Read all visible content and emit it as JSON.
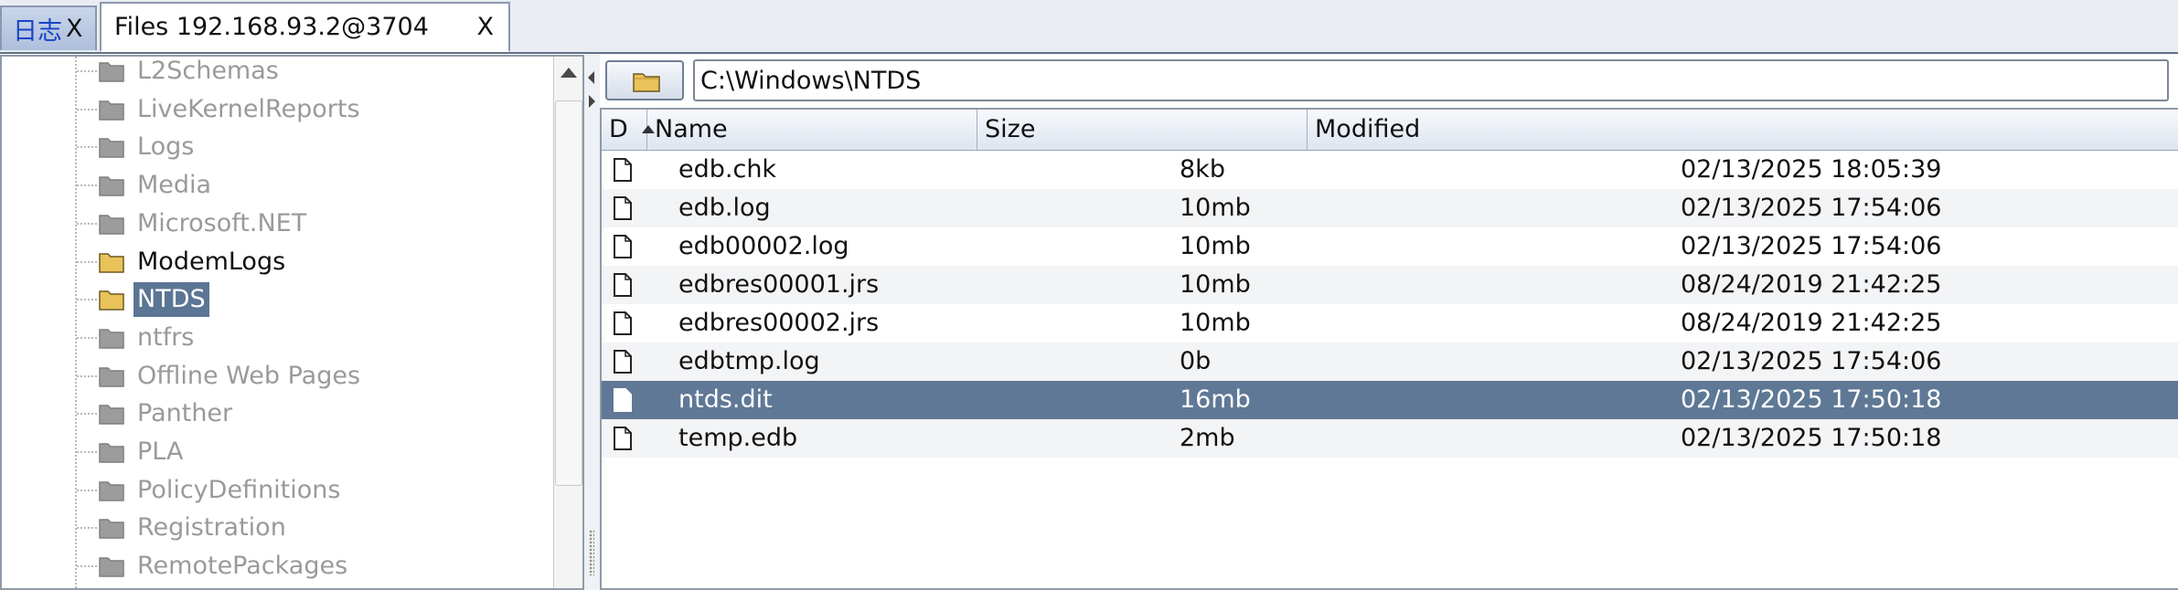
{
  "tabs": [
    {
      "label": "日志",
      "close": "X"
    },
    {
      "label": "Files 192.168.93.2@3704",
      "close": "X"
    }
  ],
  "tree": {
    "items": [
      {
        "name": "L2Schemas",
        "state": "dim"
      },
      {
        "name": "LiveKernelReports",
        "state": "dim"
      },
      {
        "name": "Logs",
        "state": "dim"
      },
      {
        "name": "Media",
        "state": "dim"
      },
      {
        "name": "Microsoft.NET",
        "state": "dim"
      },
      {
        "name": "ModemLogs",
        "state": "bright"
      },
      {
        "name": "NTDS",
        "state": "selected"
      },
      {
        "name": "ntfrs",
        "state": "dim"
      },
      {
        "name": "Offline Web Pages",
        "state": "dim"
      },
      {
        "name": "Panther",
        "state": "dim"
      },
      {
        "name": "PLA",
        "state": "dim"
      },
      {
        "name": "PolicyDefinitions",
        "state": "dim"
      },
      {
        "name": "Registration",
        "state": "dim"
      },
      {
        "name": "RemotePackages",
        "state": "dim"
      }
    ]
  },
  "path": {
    "value": "C:\\Windows\\NTDS",
    "icon": "folder-icon"
  },
  "table": {
    "headers": {
      "d": "D",
      "name": "Name",
      "size": "Size",
      "modified": "Modified"
    },
    "rows": [
      {
        "name": "edb.chk",
        "size": "8kb",
        "modified": "02/13/2025 18:05:39"
      },
      {
        "name": "edb.log",
        "size": "10mb",
        "modified": "02/13/2025 17:54:06"
      },
      {
        "name": "edb00002.log",
        "size": "10mb",
        "modified": "02/13/2025 17:54:06"
      },
      {
        "name": "edbres00001.jrs",
        "size": "10mb",
        "modified": "08/24/2019 21:42:25"
      },
      {
        "name": "edbres00002.jrs",
        "size": "10mb",
        "modified": "08/24/2019 21:42:25"
      },
      {
        "name": "edbtmp.log",
        "size": "0b",
        "modified": "02/13/2025 17:54:06"
      },
      {
        "name": "ntds.dit",
        "size": "16mb",
        "modified": "02/13/2025 17:50:18",
        "selected": true
      },
      {
        "name": "temp.edb",
        "size": "2mb",
        "modified": "02/13/2025 17:50:18"
      }
    ]
  },
  "colors": {
    "selection": "#5f7895",
    "tab_active_text": "#1a44c8"
  }
}
